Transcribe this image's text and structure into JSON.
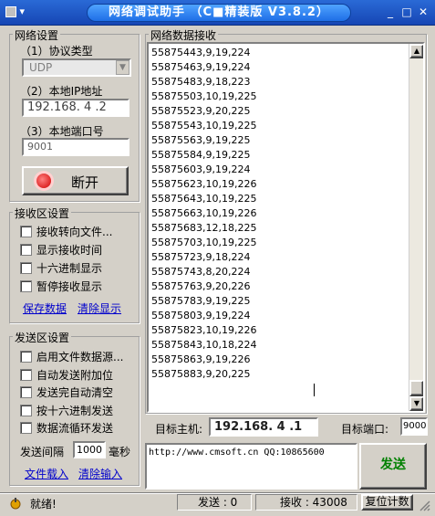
{
  "window": {
    "title": "网络调试助手 （C■精装版 V3.8.2）",
    "sysmenu": "▾"
  },
  "net_settings": {
    "group": "网络设置",
    "protocol_label": "（1）协议类型",
    "protocol_value": "UDP",
    "ip_label": "（2）本地IP地址",
    "ip_value": "192.168. 4 .2",
    "port_label": "（3）本地端口号",
    "port_value": "9001",
    "disconnect_label": "断开"
  },
  "recv_settings": {
    "group": "接收区设置",
    "options": [
      "接收转向文件...",
      "显示接收时间",
      "十六进制显示",
      "暂停接收显示"
    ],
    "save_link": "保存数据",
    "clear_link": "清除显示"
  },
  "send_settings": {
    "group": "发送区设置",
    "options": [
      "启用文件数据源...",
      "自动发送附加位",
      "发送完自动清空",
      "按十六进制发送",
      "数据流循环发送"
    ],
    "interval_label": "发送间隔",
    "interval_value": "1000",
    "interval_unit": "毫秒",
    "load_link": "文件载入",
    "clear_link": "清除输入"
  },
  "recv_area": {
    "group": "网络数据接收",
    "lines": [
      "55875443,9,19,224",
      "55875463,9,19,224",
      "55875483,9,18,223",
      "55875503,10,19,225",
      "55875523,9,20,225",
      "55875543,10,19,225",
      "55875563,9,19,225",
      "55875584,9,19,225",
      "55875603,9,19,224",
      "55875623,10,19,226",
      "55875643,10,19,225",
      "55875663,10,19,226",
      "55875683,12,18,225",
      "55875703,10,19,225",
      "55875723,9,18,224",
      "55875743,8,20,224",
      "55875763,9,20,226",
      "55875783,9,19,225",
      "55875803,9,19,224",
      "55875823,10,19,226",
      "55875843,10,18,224",
      "55875863,9,19,226",
      "55875883,9,20,225"
    ]
  },
  "target": {
    "host_label": "目标主机:",
    "host_value": "192.168. 4 .1",
    "port_label": "目标端口:",
    "port_value": "9000"
  },
  "send_area": {
    "text": "http://www.cmsoft.cn QQ:10865600",
    "send_button": "发送"
  },
  "status": {
    "ready": "就绪!",
    "send_label": "发送 : 0",
    "recv_label": "接收 : 43008",
    "reset_button": "复位计数"
  }
}
